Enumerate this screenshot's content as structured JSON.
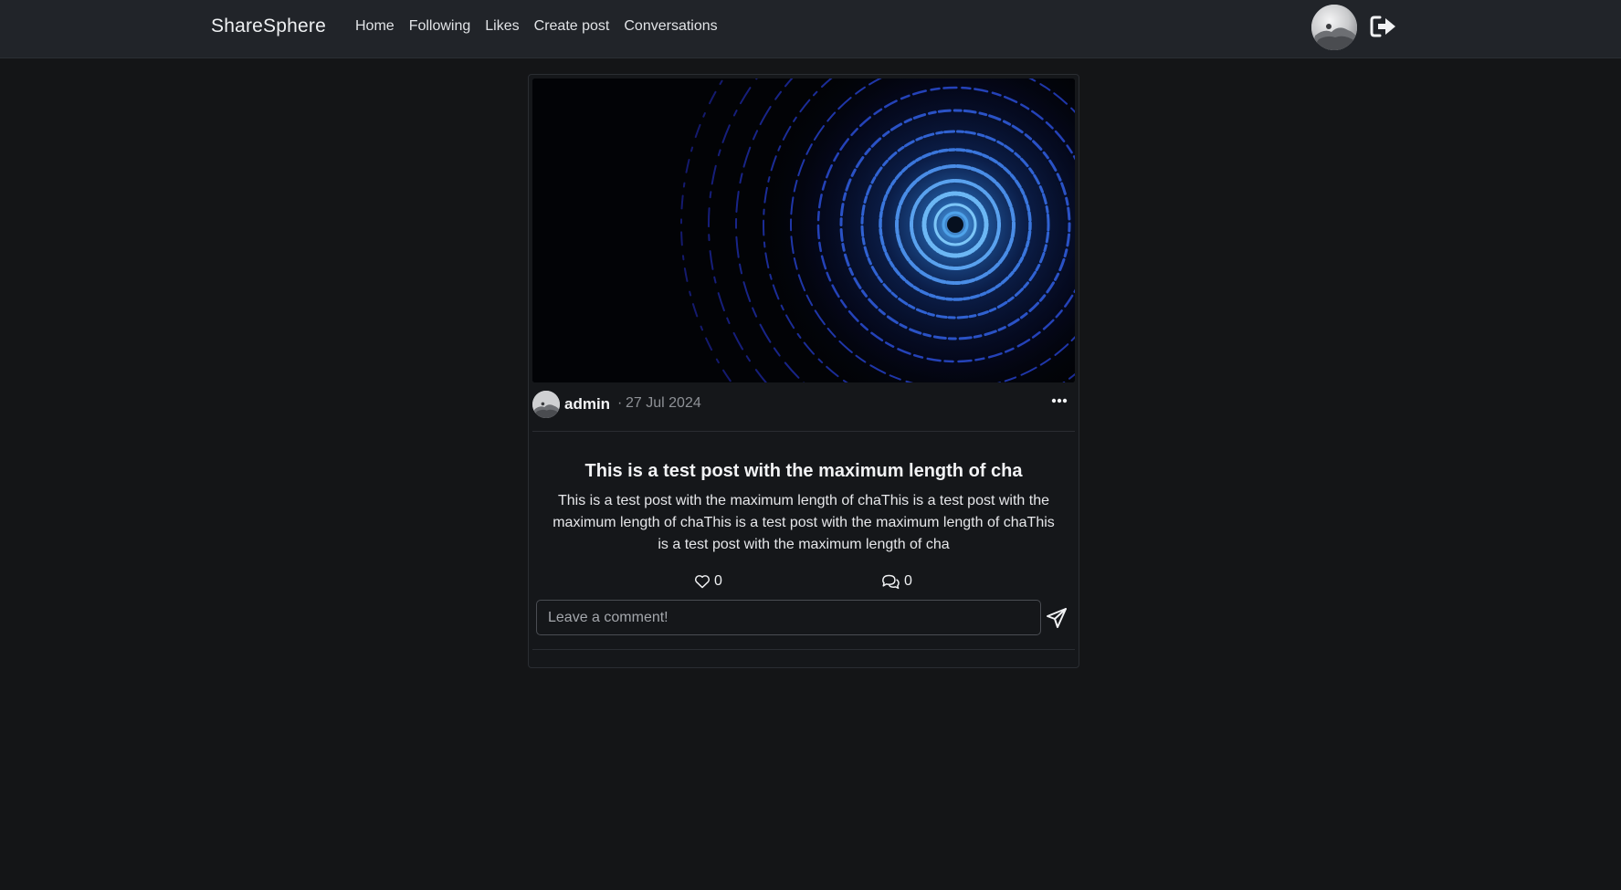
{
  "navbar": {
    "brand": "ShareSphere",
    "links": [
      "Home",
      "Following",
      "Likes",
      "Create post",
      "Conversations"
    ]
  },
  "post": {
    "author": "admin",
    "separator": "·",
    "date": "27 Jul 2024",
    "title": "This is a test post with the maximum length of cha",
    "body": "This is a test post with the maximum length of chaThis is a test post with the maximum length of chaThis is a test post with the maximum length of chaThis is a test post with the maximum length of cha",
    "likes": "0",
    "comments": "0"
  },
  "comment_form": {
    "placeholder": "Leave a comment!"
  },
  "icons": {
    "logout": "logout-icon",
    "more": "more-horizontal-icon",
    "like": "heart-icon",
    "comment": "chat-bubbles-icon",
    "send": "send-icon"
  },
  "colors": {
    "background": "#141517",
    "navbar": "#212429",
    "text": "#e6e7ea",
    "muted": "#8e9196"
  }
}
